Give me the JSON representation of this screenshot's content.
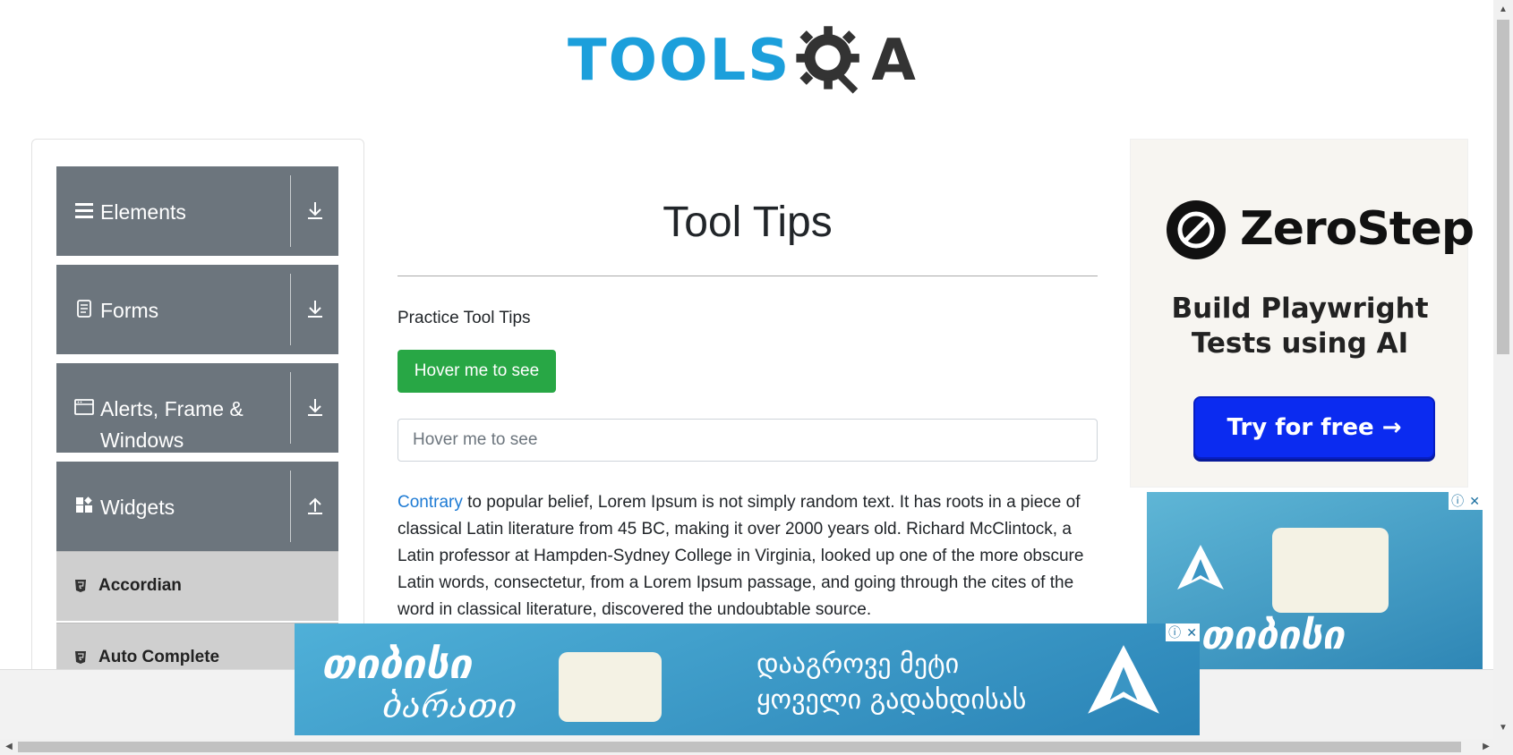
{
  "header": {
    "logo_text": "TOOLS",
    "logo_suffix": "A"
  },
  "sidebar": {
    "groups": [
      {
        "label": "Elements",
        "icon": "menu-icon",
        "arrow": "down"
      },
      {
        "label": "Forms",
        "icon": "document-icon",
        "arrow": "down"
      },
      {
        "label": "Alerts, Frame & Windows",
        "icon": "window-icon",
        "arrow": "down"
      },
      {
        "label": "Widgets",
        "icon": "widgets-icon",
        "arrow": "up"
      }
    ],
    "items": [
      {
        "label": "Accordian"
      },
      {
        "label": "Auto Complete"
      }
    ]
  },
  "main": {
    "title": "Tool Tips",
    "subtitle": "Practice Tool Tips",
    "button_label": "Hover me to see",
    "input_placeholder": "Hover me to see",
    "paragraph_link": "Contrary",
    "paragraph_text": " to popular belief, Lorem Ipsum is not simply random text. It has roots in a piece of classical Latin literature from 45 BC, making it over 2000 years old. Richard McClintock, a Latin professor at Hampden-Sydney College in Virginia, looked up one of the more obscure Latin words, consectetur, from a Lorem Ipsum passage, and going through the cites of the word in classical literature, discovered the undoubtable source."
  },
  "ad_right": {
    "brand": "ZeroStep",
    "tagline_line1": "Build Playwright",
    "tagline_line2": "Tests using AI",
    "cta": "Try for free →"
  },
  "ad_card": {
    "brand_text": "თიბისი"
  },
  "banner": {
    "brand_line1": "თიბისი",
    "brand_line2": "ბარათი",
    "line1": "დააგროვე მეტი",
    "line2": "ყოველი გადახდისას",
    "info_icon": "ⓘ",
    "close_icon": "✕"
  },
  "colors": {
    "logo_blue": "#1c9fdb",
    "sidebar_group": "#6c757d",
    "sidebar_item": "#cfcfcf",
    "button_green": "#28a745",
    "link_blue": "#1e7bd4",
    "cta_blue": "#0b2bf0"
  }
}
